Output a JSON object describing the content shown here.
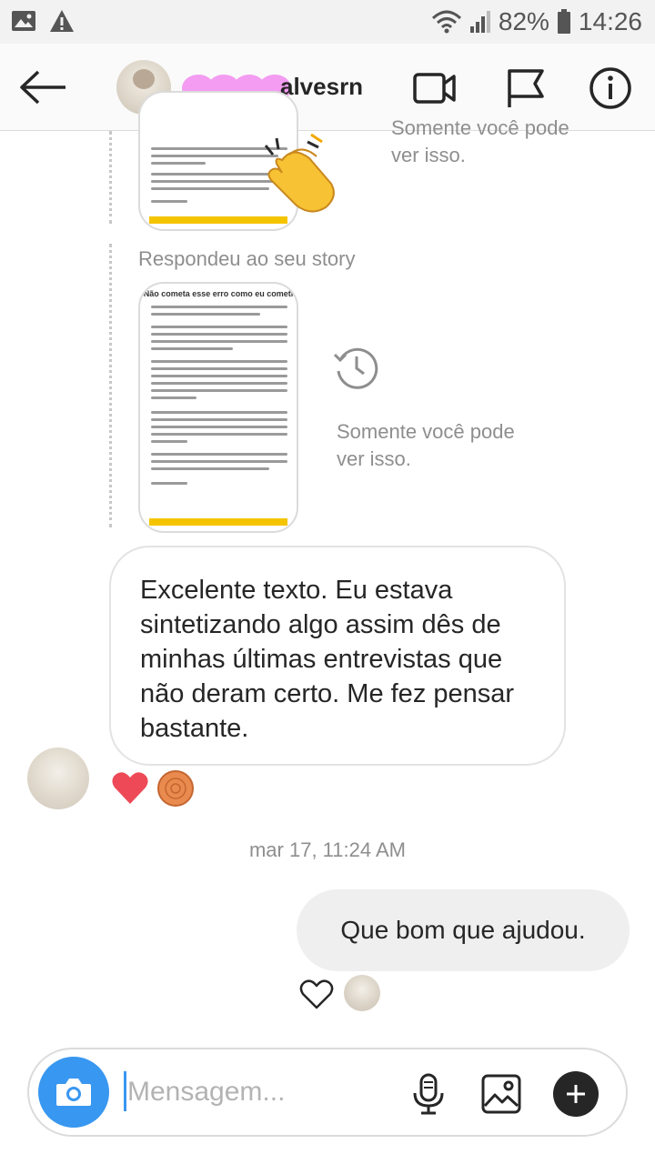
{
  "status_bar": {
    "battery_percent": "82%",
    "time": "14:26",
    "left_icons": [
      "image-icon",
      "warning-icon"
    ],
    "right_icons": [
      "wifi-icon",
      "signal-icon",
      "battery-icon"
    ]
  },
  "header": {
    "username_visible": "alvesrn",
    "masked_name_color": "#f39cf1",
    "icons": [
      "back-arrow-icon",
      "video-call-icon",
      "flag-icon",
      "info-icon"
    ]
  },
  "messages": {
    "story1_note": "Somente você pode ver isso.",
    "story2_header": "Respondeu ao seu story",
    "story2_card_title": "Não cometa esse erro como eu cometi",
    "story2_note": "Somente você pode ver isso.",
    "incoming_text": "Excelente texto. Eu estava sintetizando algo assim dês de minhas últimas entrevistas que não deram certo. Me fez pensar bastante.",
    "reactions": [
      "heart-red",
      "orange-emoji"
    ],
    "timestamp": "mar 17, 11:24 AM",
    "outgoing_text": "Que bom que ajudou."
  },
  "composer": {
    "placeholder": "Mensagem..."
  },
  "colors": {
    "accent_blue": "#3897f0",
    "heart_red": "#ed4956",
    "muted_text": "#8e8e8e",
    "story_yellow": "#f5c400"
  }
}
